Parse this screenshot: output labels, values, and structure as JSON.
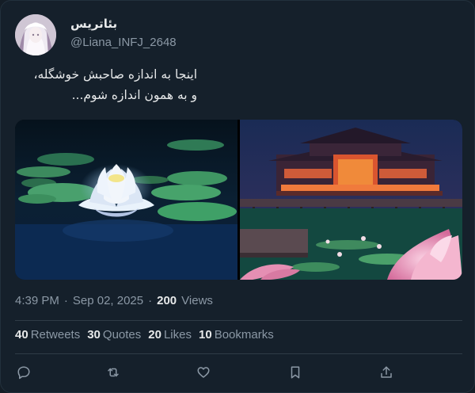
{
  "author": {
    "display_name": "بئاتریس",
    "handle": "@Liana_INFJ_2648"
  },
  "tweet": {
    "line1": "اینجا به اندازه صاحبش خوشگله،",
    "line2": "و به همون اندازه شوم..."
  },
  "meta": {
    "time": "4:39 PM",
    "dot1": "·",
    "date": "Sep 02, 2025",
    "dot2": "·",
    "views_count": "200",
    "views_label": "Views"
  },
  "stats": [
    {
      "count": "40",
      "label": "Retweets"
    },
    {
      "count": "30",
      "label": "Quotes"
    },
    {
      "count": "20",
      "label": "Likes"
    },
    {
      "count": "10",
      "label": "Bookmarks"
    }
  ],
  "actions": [
    "reply-icon",
    "retweet-icon",
    "like-icon",
    "bookmark-icon",
    "share-icon"
  ],
  "colors": {
    "background": "#15202b",
    "text": "#e7e9ea",
    "muted": "#8b98a5",
    "divider": "#2f3b47"
  }
}
